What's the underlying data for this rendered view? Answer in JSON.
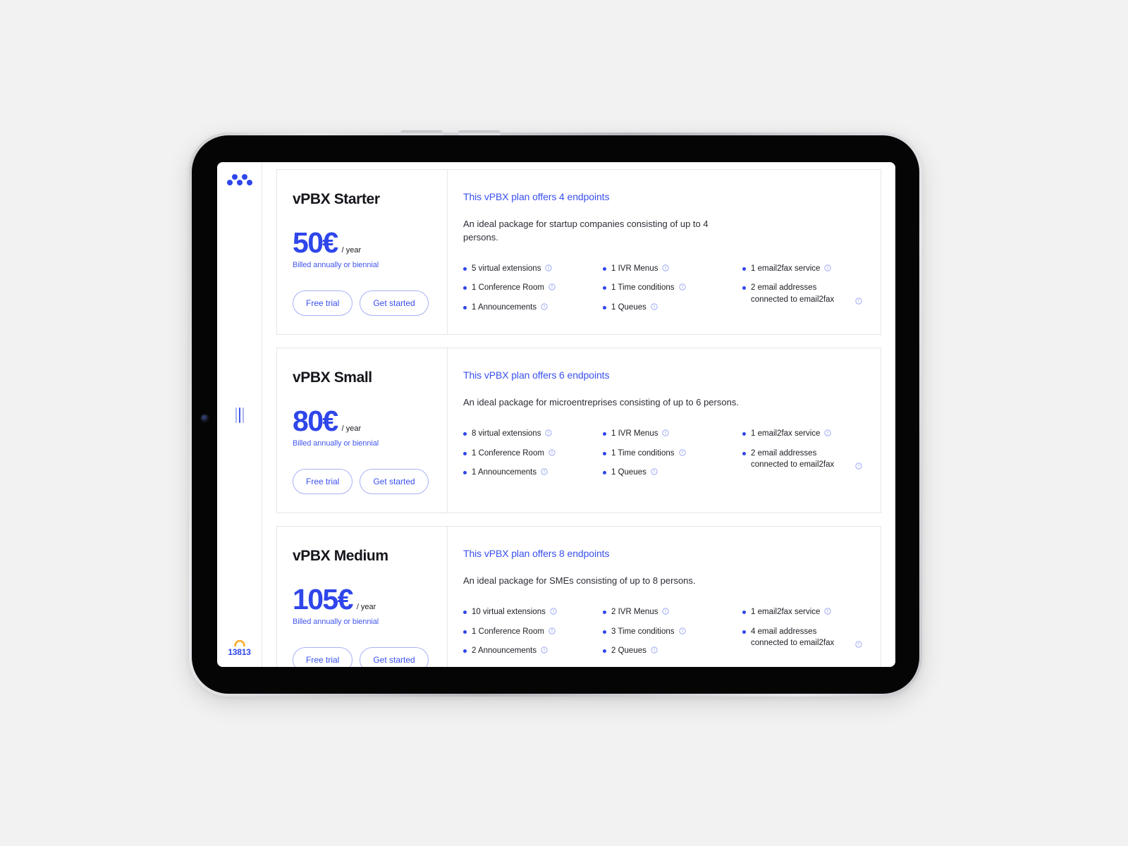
{
  "device": {
    "type": "tablet",
    "camera_icon": "front-camera-icon",
    "volume_buttons": [
      "volume-up-button",
      "volume-down-button"
    ]
  },
  "rail": {
    "logo": "brand-dots-logo-icon",
    "handle": "panel-resize-handle",
    "handset_icon": "phone-handset-icon",
    "extension_number": "13813"
  },
  "theme": {
    "brand_blue": "#2f46ea",
    "link_blue": "#3a50ee",
    "note_blue": "#4358ee",
    "border_grey": "#e6e6ea",
    "text_dark": "#15161c",
    "accent_orange": "#f7a928",
    "page_bg": "#f2f2f2"
  },
  "buttons": {
    "free_trial": "Free trial",
    "get_started": "Get started"
  },
  "price_period": "/ year",
  "billing_note": "Billed annually or biennial",
  "plans": [
    {
      "title": "vPBX Starter",
      "price": "50€",
      "period": "/ year",
      "note": "Billed annually or biennial",
      "endpoints": "This vPBX plan offers 4 endpoints",
      "description": "An ideal package for startup companies consisting of up to 4 persons.",
      "columns": [
        [
          "5 virtual extensions",
          "1 Conference Room",
          "1 Announcements"
        ],
        [
          "1 IVR Menus",
          "1 Time conditions",
          "1 Queues"
        ],
        [
          "1 email2fax service",
          "2 email addresses connected to email2fax"
        ]
      ]
    },
    {
      "title": "vPBX Small",
      "price": "80€",
      "period": "/ year",
      "note": "Billed annually or biennial",
      "endpoints": "This vPBX plan offers 6 endpoints",
      "description": "An ideal package for microentreprises consisting of up to 6 persons.",
      "columns": [
        [
          "8 virtual extensions",
          "1 Conference Room",
          "1 Announcements"
        ],
        [
          "1 IVR Menus",
          "1 Time conditions",
          "1 Queues"
        ],
        [
          "1 email2fax service",
          "2 email addresses connected to email2fax"
        ]
      ]
    },
    {
      "title": "vPBX Medium",
      "price": "105€",
      "period": "/ year",
      "note": "Billed annually or biennial",
      "endpoints": "This vPBX plan offers 8 endpoints",
      "description": "An ideal package for SMEs consisting of up to 8 persons.",
      "columns": [
        [
          "10 virtual extensions",
          "1 Conference Room",
          "2 Announcements"
        ],
        [
          "2 IVR Menus",
          "3 Time conditions",
          "2 Queues"
        ],
        [
          "1 email2fax service",
          "4 email addresses connected to email2fax"
        ]
      ]
    }
  ]
}
